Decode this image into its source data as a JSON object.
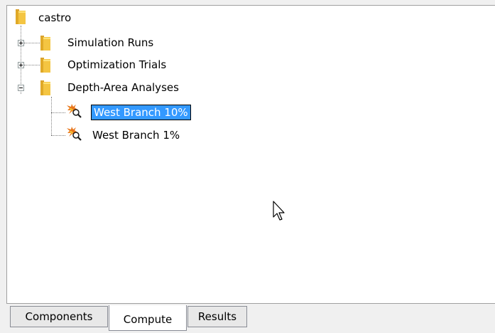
{
  "tree": {
    "root": {
      "label": "castro",
      "icon": "folder-icon"
    },
    "items": [
      {
        "label": "Simulation Runs",
        "expanded": false,
        "icon": "folder-icon"
      },
      {
        "label": "Optimization Trials",
        "expanded": false,
        "icon": "folder-icon"
      },
      {
        "label": "Depth-Area Analyses",
        "expanded": true,
        "icon": "folder-icon",
        "children": [
          {
            "label": "West Branch 10%",
            "selected": true,
            "icon": "depth-area-analysis-icon"
          },
          {
            "label": "West Branch 1%",
            "selected": false,
            "icon": "depth-area-analysis-icon"
          }
        ]
      }
    ]
  },
  "tabs": [
    {
      "label": "Components",
      "active": false
    },
    {
      "label": "Compute",
      "active": true
    },
    {
      "label": "Results",
      "active": false
    }
  ],
  "colors": {
    "selection": "#3399ff",
    "folder": "#f0c040",
    "panel": "#ffffff",
    "background": "#f0f0f0"
  }
}
